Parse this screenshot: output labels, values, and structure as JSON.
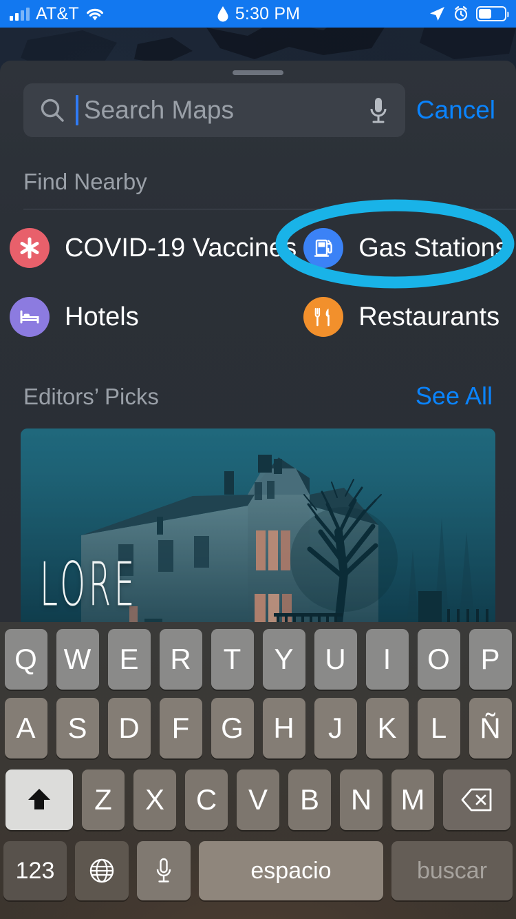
{
  "status_bar": {
    "carrier": "AT&T",
    "time": "5:30 PM",
    "signal_icon": "cellular-bars-icon",
    "wifi_icon": "wifi-icon",
    "navigation_icon": "location-arrow-icon",
    "alarm_icon": "alarm-clock-icon",
    "battery_icon": "battery-icon",
    "battery_level_pct": 50,
    "background_color": "#1278f0"
  },
  "search": {
    "placeholder": "Search Maps",
    "value": "",
    "cancel_label": "Cancel",
    "search_icon": "search-icon",
    "mic_icon": "microphone-icon",
    "cursor_color": "#2f7bf6"
  },
  "find_nearby": {
    "title": "Find Nearby",
    "items": [
      {
        "label": "COVID-19 Vaccines",
        "icon": "asterisk-icon",
        "color": "#e8606b"
      },
      {
        "label": "Gas Stations",
        "icon": "gas-pump-icon",
        "color": "#3b82f6"
      },
      {
        "label": "Hotels",
        "icon": "bed-icon",
        "color": "#8c7be0"
      },
      {
        "label": "Restaurants",
        "icon": "fork-knife-icon",
        "color": "#f2902c"
      }
    ]
  },
  "editors_picks": {
    "title": "Editors’ Picks",
    "see_all_label": "See All",
    "card_title": "LORE"
  },
  "keyboard": {
    "language": "Spanish",
    "row1": [
      "Q",
      "W",
      "E",
      "R",
      "T",
      "Y",
      "U",
      "I",
      "O",
      "P"
    ],
    "row2": [
      "A",
      "S",
      "D",
      "F",
      "G",
      "H",
      "J",
      "K",
      "L",
      "Ñ"
    ],
    "row3": [
      "Z",
      "X",
      "C",
      "V",
      "B",
      "N",
      "M"
    ],
    "shift_icon": "shift-arrow-icon",
    "shift_active": true,
    "backspace_icon": "delete-left-icon",
    "numbers_label": "123",
    "globe_icon": "globe-icon",
    "dictation_icon": "microphone-icon",
    "space_label": "espacio",
    "return_label": "buscar"
  },
  "annotation": {
    "shape": "ellipse",
    "target": "Gas Stations",
    "color": "#19b3e8"
  }
}
